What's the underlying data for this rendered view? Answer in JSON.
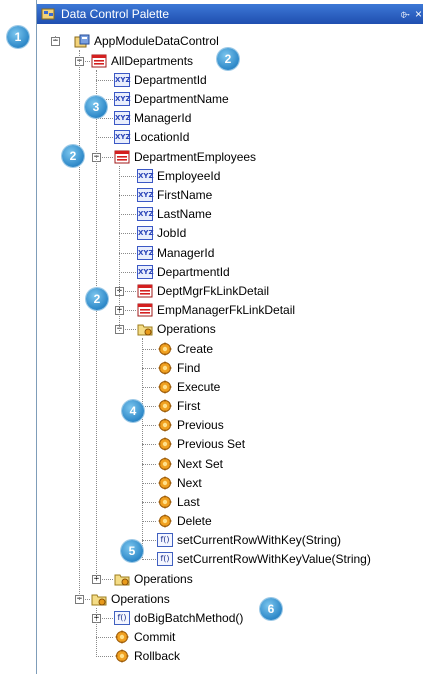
{
  "panel": {
    "title": "Data Control Palette",
    "pin_glyph": "⌱",
    "close_glyph": "×"
  },
  "nodes": [
    {
      "id": "root",
      "label": "AppModuleDataControl",
      "icon": "app-module-icon"
    },
    {
      "id": "alldept",
      "label": "AllDepartments",
      "icon": "collection-icon"
    },
    {
      "id": "a1",
      "label": "DepartmentId",
      "icon": "attribute-icon"
    },
    {
      "id": "a2",
      "label": "DepartmentName",
      "icon": "attribute-icon"
    },
    {
      "id": "a3",
      "label": "ManagerId",
      "icon": "attribute-icon"
    },
    {
      "id": "a4",
      "label": "LocationId",
      "icon": "attribute-icon"
    },
    {
      "id": "deptemp",
      "label": "DepartmentEmployees",
      "icon": "collection-icon"
    },
    {
      "id": "e1",
      "label": "EmployeeId",
      "icon": "attribute-icon"
    },
    {
      "id": "e2",
      "label": "FirstName",
      "icon": "attribute-icon"
    },
    {
      "id": "e3",
      "label": "LastName",
      "icon": "attribute-icon"
    },
    {
      "id": "e4",
      "label": "JobId",
      "icon": "attribute-icon"
    },
    {
      "id": "e5",
      "label": "ManagerId",
      "icon": "attribute-icon"
    },
    {
      "id": "e6",
      "label": "DepartmentId",
      "icon": "attribute-icon"
    },
    {
      "id": "l1",
      "label": "DeptMgrFkLinkDetail",
      "icon": "collection-icon"
    },
    {
      "id": "l2",
      "label": "EmpManagerFkLinkDetail",
      "icon": "collection-icon"
    },
    {
      "id": "ops1",
      "label": "Operations",
      "icon": "operations-folder-icon"
    },
    {
      "id": "o1",
      "label": "Create",
      "icon": "operation-icon"
    },
    {
      "id": "o2",
      "label": "Find",
      "icon": "operation-icon"
    },
    {
      "id": "o3",
      "label": "Execute",
      "icon": "operation-icon"
    },
    {
      "id": "o4",
      "label": "First",
      "icon": "operation-icon"
    },
    {
      "id": "o5",
      "label": "Previous",
      "icon": "operation-icon"
    },
    {
      "id": "o6",
      "label": "Previous Set",
      "icon": "operation-icon"
    },
    {
      "id": "o7",
      "label": "Next Set",
      "icon": "operation-icon"
    },
    {
      "id": "o8",
      "label": "Next",
      "icon": "operation-icon"
    },
    {
      "id": "o9",
      "label": "Last",
      "icon": "operation-icon"
    },
    {
      "id": "o10",
      "label": "Delete",
      "icon": "operation-icon"
    },
    {
      "id": "m1",
      "label": "setCurrentRowWithKey(String)",
      "icon": "method-icon"
    },
    {
      "id": "m2",
      "label": "setCurrentRowWithKeyValue(String)",
      "icon": "method-icon"
    },
    {
      "id": "ops2",
      "label": "Operations",
      "icon": "operations-folder-icon"
    },
    {
      "id": "ops3",
      "label": "Operations",
      "icon": "operations-folder-icon"
    },
    {
      "id": "b1",
      "label": "doBigBatchMethod()",
      "icon": "method-icon"
    },
    {
      "id": "b2",
      "label": "Commit",
      "icon": "operation-icon"
    },
    {
      "id": "b3",
      "label": "Rollback",
      "icon": "operation-icon"
    }
  ],
  "callouts": [
    {
      "id": "c1",
      "label": "1"
    },
    {
      "id": "c2a",
      "label": "2"
    },
    {
      "id": "c3",
      "label": "3"
    },
    {
      "id": "c2b",
      "label": "2"
    },
    {
      "id": "c2c",
      "label": "2"
    },
    {
      "id": "c4",
      "label": "4"
    },
    {
      "id": "c5",
      "label": "5"
    },
    {
      "id": "c6",
      "label": "6"
    }
  ],
  "icon_text": {
    "attribute": "XYZ",
    "method": "f()"
  },
  "expander_glyphs": {
    "expanded": "−",
    "collapsed": "+"
  }
}
